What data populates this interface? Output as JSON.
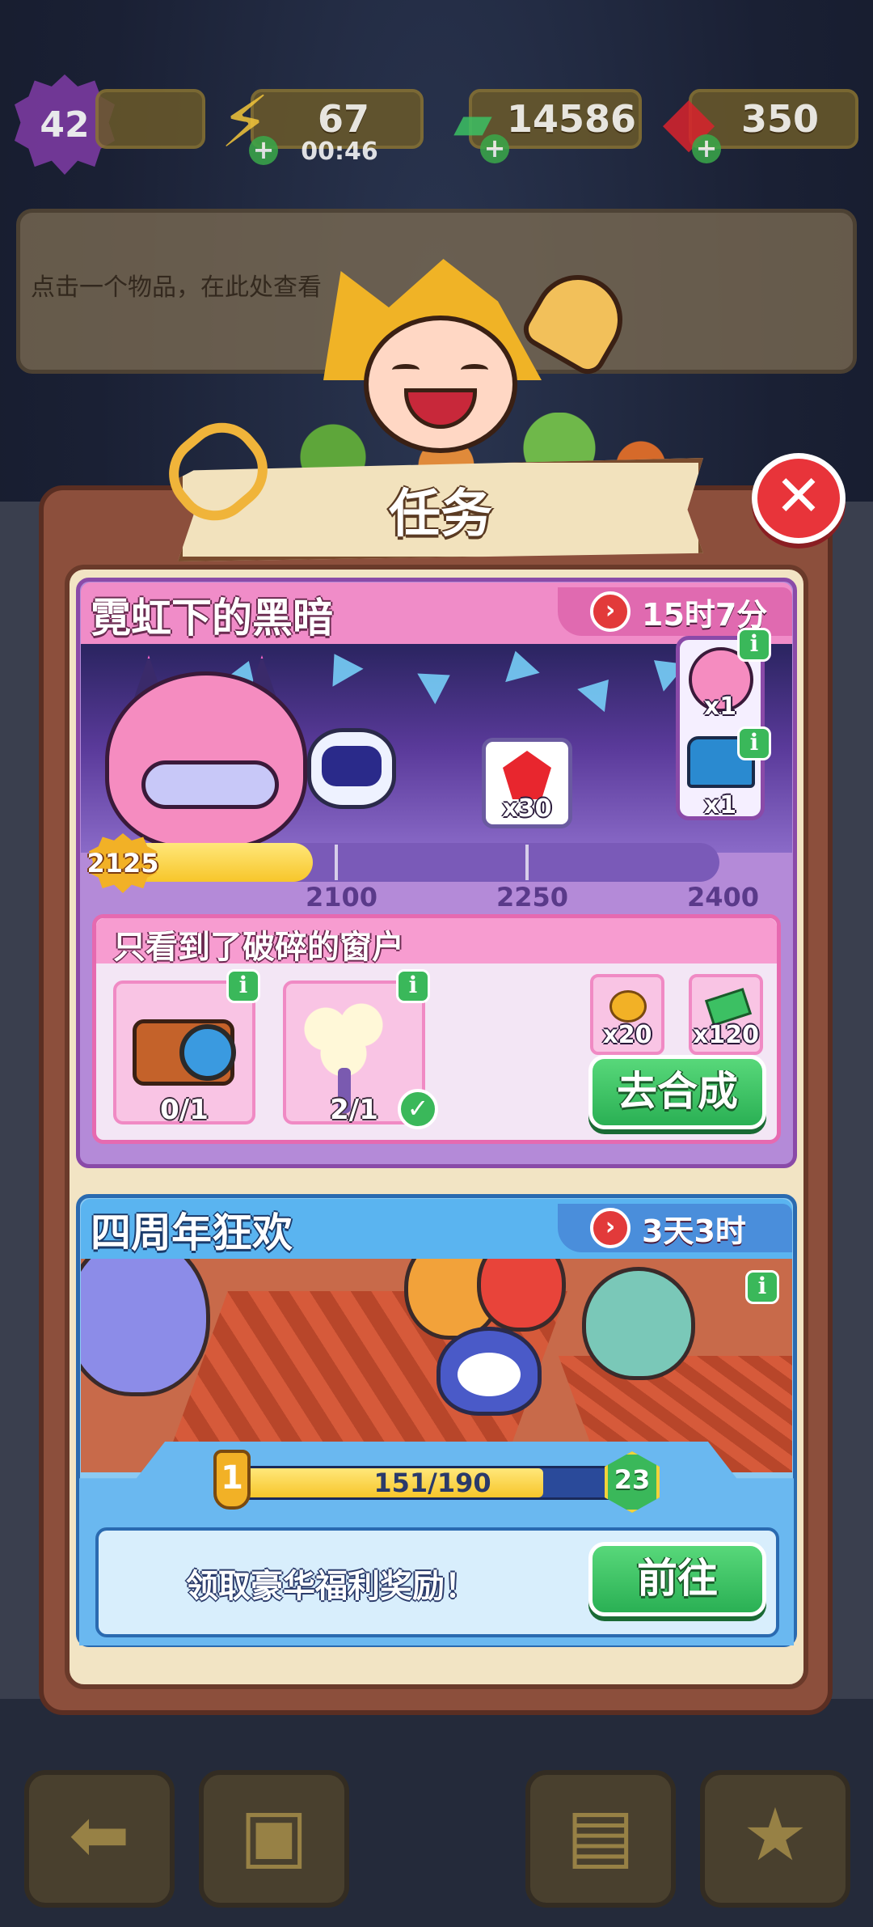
{
  "resources": {
    "level": "42",
    "energy": "67",
    "energy_timer": "00:46",
    "cash": "14586",
    "gems": "350"
  },
  "info_hint": "点击一个物品，在此处查看",
  "panel": {
    "title": "任务",
    "close_glyph": "✕"
  },
  "event1": {
    "title": "霓虹下的黑暗",
    "timer": "15时7分",
    "milestone_reward_qty": "x30",
    "side_rewards": [
      {
        "qty": "x1"
      },
      {
        "qty": "x1"
      }
    ],
    "score": "2125",
    "ticks": [
      "2100",
      "2250",
      "2400"
    ],
    "progress_fraction": 0.32,
    "task": {
      "title": "只看到了破碎的窗户",
      "items": [
        {
          "icon": "camera-icon",
          "count": "0/1",
          "complete": false
        },
        {
          "icon": "tree-icon",
          "count": "2/1",
          "complete": true
        }
      ],
      "rewards": [
        {
          "icon": "coin-icon",
          "qty": "x20"
        },
        {
          "icon": "cash-icon",
          "qty": "x120"
        }
      ],
      "button": "去合成"
    }
  },
  "event2": {
    "title": "四周年狂欢",
    "timer": "3天3时",
    "rank": "1",
    "progress_text": "151/190",
    "progress_fraction": 0.795,
    "level": "23",
    "claim_text": "领取豪华福利奖励！",
    "button": "前往"
  },
  "info_glyph": "i",
  "check_glyph": "✓",
  "clock_glyph": "›",
  "colors": {
    "accent_green": "#2ab054",
    "close_red": "#e8343a",
    "event1_pink": "#f08cc8",
    "event2_blue": "#5ab4f0",
    "progress_yellow": "#f7c62a"
  }
}
